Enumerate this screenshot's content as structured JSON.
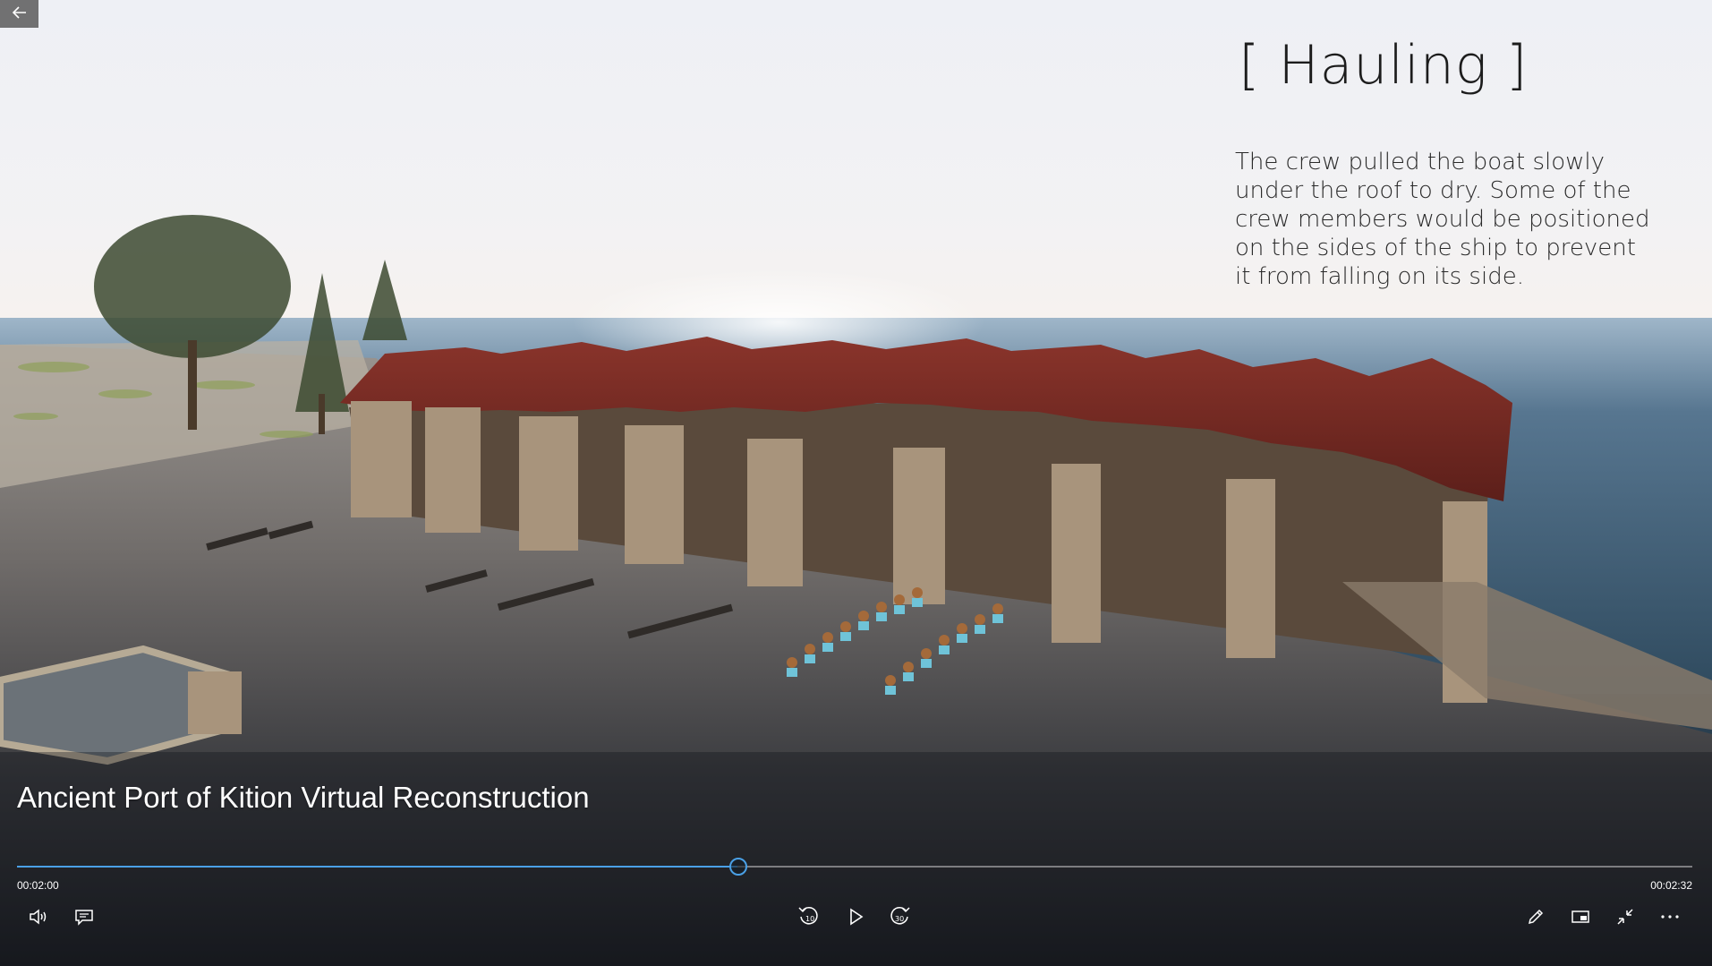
{
  "overlay": {
    "title": "[ Hauling ]",
    "description": "The crew pulled the boat slowly under the roof to dry. Some of the crew members would be positioned on the sides of the ship to prevent it from falling on its side."
  },
  "video": {
    "title": "Ancient Port of Kition Virtual Reconstruction",
    "current_time": "00:02:00",
    "total_time": "00:02:32",
    "progress": 0.43
  },
  "controls": {
    "back": "back-arrow-icon",
    "volume": "volume-icon",
    "captions": "captions-icon",
    "skip_back": "skip-back-10-icon",
    "play": "play-icon",
    "skip_forward": "skip-forward-30-icon",
    "edit": "pencil-icon",
    "mini_view": "mini-view-icon",
    "exit_fullscreen": "exit-fullscreen-icon",
    "more": "more-icon",
    "skip_back_label": "10",
    "skip_forward_label": "30"
  },
  "colors": {
    "accent": "#4aa0e6",
    "roof": "#7a2a24",
    "stone": "#a8947c",
    "sea": "#3e5a74"
  }
}
